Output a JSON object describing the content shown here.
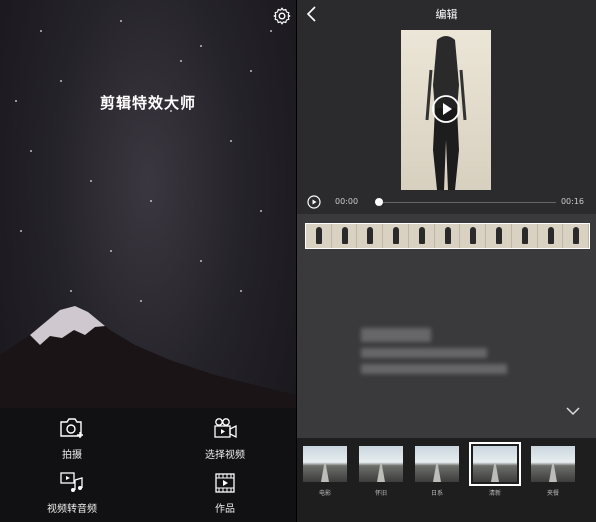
{
  "home": {
    "title": "剪辑特效大师",
    "actions": [
      {
        "label": "拍摄",
        "icon": "camera-add-icon"
      },
      {
        "label": "选择视频",
        "icon": "video-camera-icon"
      },
      {
        "label": "视频转音频",
        "icon": "video-to-audio-icon"
      },
      {
        "label": "作品",
        "icon": "film-works-icon"
      }
    ],
    "settings_icon": "gear-icon"
  },
  "editor": {
    "title": "编辑",
    "back_icon": "back-chevron-icon",
    "time_start": "00:00",
    "time_end": "00:16",
    "playback_progress": 0,
    "filters": [
      "电影",
      "怀旧",
      "日系",
      "清新",
      "夹餐"
    ],
    "selected_filter": "清新"
  }
}
